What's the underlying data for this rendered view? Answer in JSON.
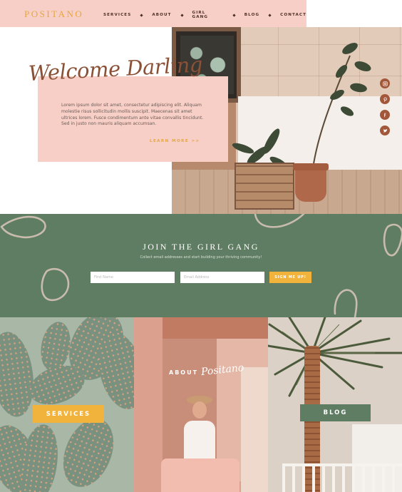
{
  "nav": {
    "logo": "POSITANO",
    "items": [
      {
        "label": "SERVICES"
      },
      {
        "label": "ABOUT"
      },
      {
        "label": "GIRL GANG"
      },
      {
        "label": "BLOG"
      },
      {
        "label": "CONTACT"
      }
    ]
  },
  "hero": {
    "title": "Welcome Darling",
    "body": "Lorem ipsum dolor sit amet, consectetur adipiscing elit. Aliquam molestie risus sollicitudin mollis suscipit. Maecenas sit amet ultrices lorem. Fusce condimentum ante vitae convallis tincidunt. Sed in justo non mauris aliquam accumsan.",
    "cta": "LEARN MORE >>"
  },
  "socials": [
    {
      "icon": "instagram-icon"
    },
    {
      "icon": "pinterest-icon"
    },
    {
      "icon": "facebook-icon"
    },
    {
      "icon": "twitter-icon"
    }
  ],
  "join": {
    "title": "JOIN THE GIRL GANG",
    "subtitle": "Collect email addresses and start building your thriving community!",
    "first_name_placeholder": "First Name",
    "email_placeholder": "Email Address",
    "button": "SIGN ME UP!"
  },
  "tiles": {
    "services_label": "SERVICES",
    "about_label": "ABOUT",
    "about_script": "Positano",
    "blog_label": "BLOG"
  },
  "colors": {
    "blush": "#f8cfc6",
    "gold": "#f2b33d",
    "sage": "#5f7d62",
    "rust": "#a2573a",
    "brown_text": "#8a5136"
  }
}
